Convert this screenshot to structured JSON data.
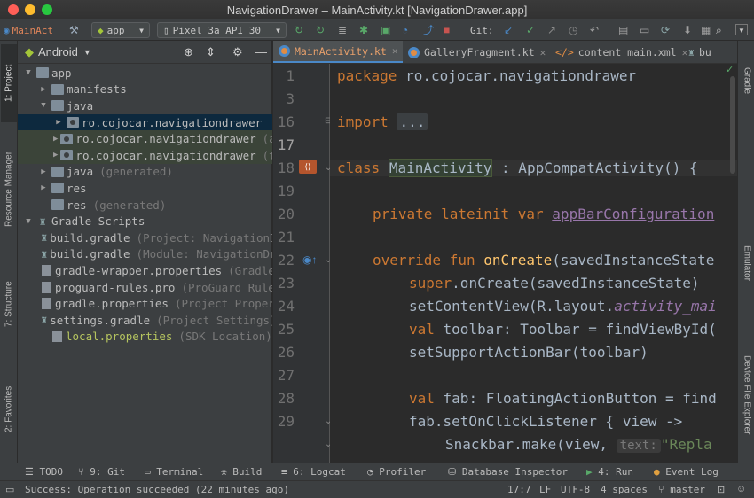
{
  "window": {
    "title": "NavigationDrawer – MainActivity.kt [NavigationDrawer.app]"
  },
  "toolbar": {
    "project_name": "MainAct",
    "run_config": "app",
    "device": "Pixel 3a API 30",
    "git_label": "Git:"
  },
  "left_tool_tabs": {
    "project": "1: Project",
    "resource_manager": "Resource Manager",
    "structure": "7: Structure",
    "favorites": "2: Favorites"
  },
  "right_tool_tabs": {
    "gradle": "Gradle",
    "emulator": "Emulator",
    "device_file_explorer": "Device File Explorer"
  },
  "project_panel": {
    "view_mode": "Android"
  },
  "tree": [
    {
      "label": "app",
      "hint": ""
    },
    {
      "label": "manifests",
      "hint": ""
    },
    {
      "label": "java",
      "hint": ""
    },
    {
      "label": "ro.cojocar.navigationdrawer",
      "hint": ""
    },
    {
      "label": "ro.cojocar.navigationdrawer",
      "hint": "(androidTest)"
    },
    {
      "label": "ro.cojocar.navigationdrawer",
      "hint": "(test)"
    },
    {
      "label": "java",
      "hint": "(generated)"
    },
    {
      "label": "res",
      "hint": ""
    },
    {
      "label": "res",
      "hint": "(generated)"
    },
    {
      "label": "Gradle Scripts",
      "hint": ""
    },
    {
      "label": "build.gradle",
      "hint": "(Project: NavigationDrawer)"
    },
    {
      "label": "build.gradle",
      "hint": "(Module: NavigationDrawer.app)"
    },
    {
      "label": "gradle-wrapper.properties",
      "hint": "(Gradle Version)"
    },
    {
      "label": "proguard-rules.pro",
      "hint": "(ProGuard Rules for NavigationDrawer.app)"
    },
    {
      "label": "gradle.properties",
      "hint": "(Project Properties)"
    },
    {
      "label": "settings.gradle",
      "hint": "(Project Settings)"
    },
    {
      "label": "local.properties",
      "hint": "(SDK Location)"
    }
  ],
  "tabs": [
    {
      "label": "MainActivity.kt"
    },
    {
      "label": "GalleryFragment.kt"
    },
    {
      "label": "content_main.xml"
    },
    {
      "label": "bu"
    }
  ],
  "line_numbers": [
    "1",
    "3",
    "16",
    "17",
    "18",
    "19",
    "20",
    "21",
    "22",
    "23",
    "24",
    "25",
    "26",
    "27",
    "28",
    "29"
  ],
  "code": {
    "l1": {
      "kw": "package",
      "rest": " ro.cojocar.navigationdrawer"
    },
    "l3": {
      "kw": "import",
      "fold": "..."
    },
    "l17": {
      "kw": "class",
      "name": "MainActivity",
      "rest": " : AppCompatActivity() {"
    },
    "l19": {
      "kw": "private lateinit var",
      "prop": "appBarConfiguration"
    },
    "l21": {
      "kw": "override fun",
      "fn": "onCreate",
      "rest": "(savedInstanceState"
    },
    "l22": {
      "kw": "super",
      "rest": ".onCreate(savedInstanceState)"
    },
    "l23": {
      "a": "setContentView(R.layout.",
      "ital": "activity_mai"
    },
    "l24": {
      "kw": "val",
      "rest": " toolbar: Toolbar = findViewById("
    },
    "l25": {
      "a": "setSupportActionBar(toolbar)"
    },
    "l27": {
      "kw": "val",
      "rest": " fab: FloatingActionButton = find"
    },
    "l28": {
      "a": "fab.setOnClickListener { view ->"
    },
    "l29": {
      "a": "Snackbar.make(view, ",
      "inlay": "text:",
      "str": "\"Repla"
    }
  },
  "bottom_tools": [
    "TODO",
    "9: Git",
    "Terminal",
    "Build",
    "6: Logcat",
    "Profiler",
    "Database Inspector",
    "4: Run",
    "Event Log"
  ],
  "status": {
    "message": "Success: Operation succeeded (22 minutes ago)",
    "position": "17:7",
    "line_sep": "LF",
    "encoding": "UTF-8",
    "indent": "4 spaces",
    "branch": "master"
  },
  "colors": {
    "accent": "#4a88c7",
    "keyword": "#cc7832",
    "function": "#ffc66d",
    "string": "#6a8759",
    "property": "#9876aa"
  }
}
